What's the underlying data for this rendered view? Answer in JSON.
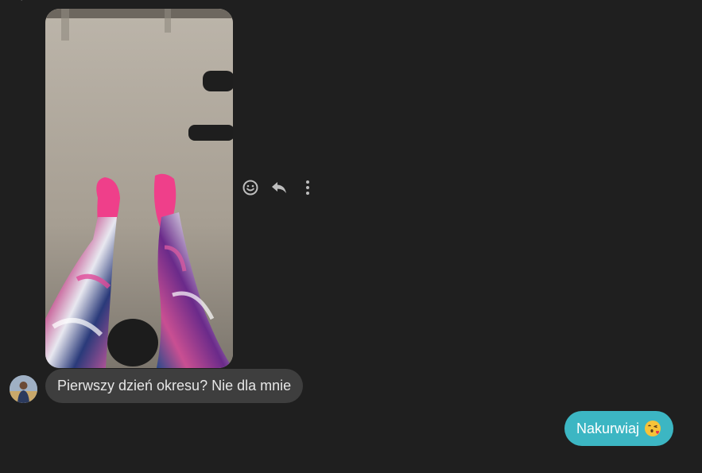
{
  "messages": {
    "incoming_text": "Pierwszy dzień okresu? Nie dla mnie",
    "outgoing_text": "Nakurwiaj",
    "outgoing_emoji": "face-blowing-kiss-emoji"
  },
  "actions": {
    "react_icon": "smiley-icon",
    "reply_icon": "reply-icon",
    "more_icon": "more-vertical-icon"
  },
  "colors": {
    "background": "#1f1f1f",
    "incoming_bubble": "#3e3e3e",
    "outgoing_bubble": "#3cb6c3",
    "icon": "#bdbdbd"
  }
}
